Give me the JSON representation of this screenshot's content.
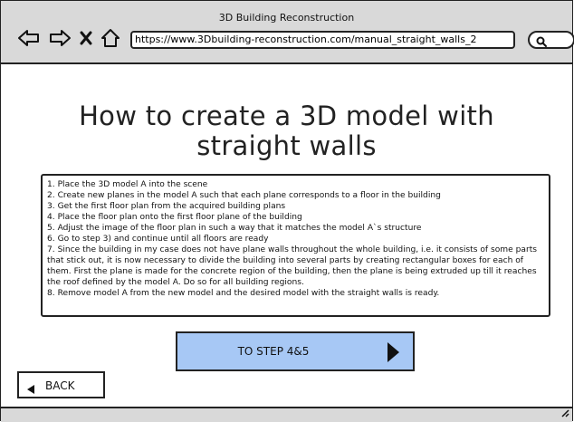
{
  "window": {
    "title": "3D Building Reconstruction"
  },
  "toolbar": {
    "icons": [
      "back-arrow-icon",
      "forward-arrow-icon",
      "close-icon",
      "home-icon",
      "search-icon"
    ],
    "url": "https://www.3Dbuilding-reconstruction.com/manual_straight_walls_2"
  },
  "main": {
    "title": "How to create a 3D model with straight walls",
    "steps": [
      "1. Place the 3D model A into the scene",
      "2. Create new planes in the model A such that each plane corresponds to a floor in the building",
      "3. Get the first floor plan from the acquired building plans",
      "4. Place the floor plan onto the first floor plane of the building",
      "5. Adjust the image of the floor plan in such a way that it matches the model A`s structure",
      "6. Go to step 3) and continue until all floors are ready",
      "7. Since the building in my case does not have plane walls throughout the whole building, i.e. it consists of some parts that stick out, it is now necessary to divide the building into several parts by creating rectangular boxes for each of them. First the plane is made for the concrete region of the building, then the plane is being extruded up till it reaches the roof defined by the model A. Do so for all building regions.",
      "8. Remove model A from the new model and the desired model with the straight walls is ready."
    ],
    "next_button": "TO STEP 4&5",
    "back_button": "BACK"
  },
  "colors": {
    "chrome": "#d9d9d9",
    "button_accent": "#a7c8f5",
    "outline": "#222222"
  }
}
